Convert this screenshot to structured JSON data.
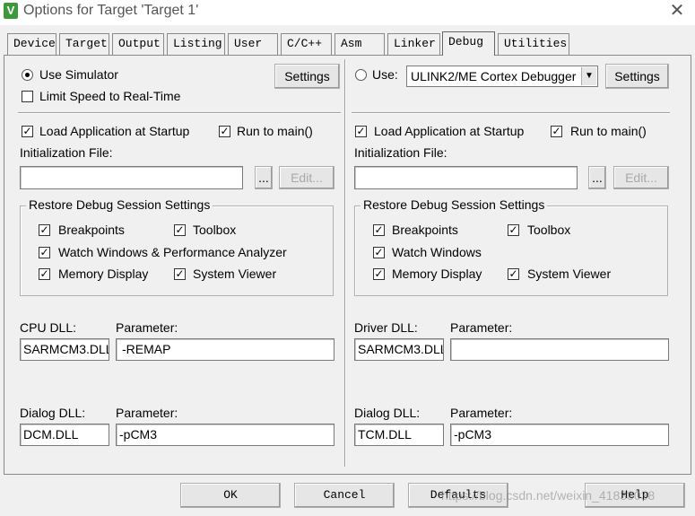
{
  "window": {
    "title": "Options for Target 'Target 1'"
  },
  "tabs": [
    {
      "label": "Device"
    },
    {
      "label": "Target"
    },
    {
      "label": "Output"
    },
    {
      "label": "Listing"
    },
    {
      "label": "User"
    },
    {
      "label": "C/C++"
    },
    {
      "label": "Asm"
    },
    {
      "label": "Linker"
    },
    {
      "label": "Debug"
    },
    {
      "label": "Utilities"
    }
  ],
  "active_tab": "Debug",
  "left": {
    "use_simulator": "Use Simulator",
    "limit_speed": "Limit Speed to Real-Time",
    "settings": "Settings",
    "load_app": "Load Application at Startup",
    "run_to_main": "Run to main()",
    "init_file": "Initialization File:",
    "browse": "...",
    "edit": "Edit...",
    "restore_title": "Restore Debug Session Settings",
    "breakpoints": "Breakpoints",
    "toolbox": "Toolbox",
    "watch": "Watch Windows & Performance Analyzer",
    "memory": "Memory Display",
    "system_viewer": "System Viewer",
    "cpu_dll_label": "CPU DLL:",
    "cpu_param_label": "Parameter:",
    "cpu_dll": "SARMCM3.DLL",
    "cpu_param": "-REMAP",
    "dialog_dll_label": "Dialog DLL:",
    "dialog_param_label": "Parameter:",
    "dialog_dll": "DCM.DLL",
    "dialog_param": "-pCM3"
  },
  "right": {
    "use": "Use:",
    "debugger": "ULINK2/ME Cortex Debugger",
    "settings": "Settings",
    "load_app": "Load Application at Startup",
    "run_to_main": "Run to main()",
    "init_file": "Initialization File:",
    "browse": "...",
    "edit": "Edit...",
    "restore_title": "Restore Debug Session Settings",
    "breakpoints": "Breakpoints",
    "toolbox": "Toolbox",
    "watch": "Watch Windows",
    "memory": "Memory Display",
    "system_viewer": "System Viewer",
    "driver_dll_label": "Driver DLL:",
    "driver_param_label": "Parameter:",
    "driver_dll": "SARMCM3.DLL",
    "driver_param": "",
    "dialog_dll_label": "Dialog DLL:",
    "dialog_param_label": "Parameter:",
    "dialog_dll": "TCM.DLL",
    "dialog_param": "-pCM3"
  },
  "buttons": {
    "ok": "OK",
    "cancel": "Cancel",
    "defaults": "Defaults",
    "help": "Help"
  },
  "watermark": "https://blog.csdn.net/weixin_41833038",
  "check_mark": "✓",
  "icons": {
    "app": "V",
    "close": "✕"
  }
}
